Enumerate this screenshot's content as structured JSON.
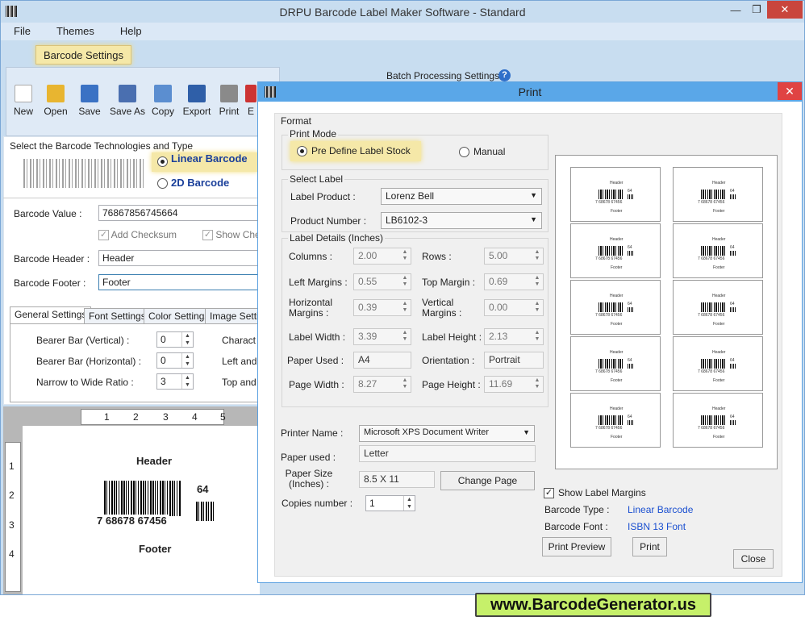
{
  "app": {
    "title": "DRPU Barcode Label Maker Software - Standard",
    "controls": [
      "—",
      "❐",
      "✕"
    ]
  },
  "menu": [
    "File",
    "Themes",
    "Help"
  ],
  "ribbon_tab": "Barcode Settings",
  "batch_label": "Batch Processing Settings",
  "toolbar": [
    "New",
    "Open",
    "Save",
    "Save As",
    "Copy",
    "Export",
    "Print",
    "E"
  ],
  "tech": {
    "caption": "Select the Barcode Technologies and Type",
    "linear": "Linear Barcode",
    "twod": "2D Barcode"
  },
  "fields": {
    "value_label": "Barcode Value :",
    "value": "76867856745664",
    "add_checksum": "Add Checksum",
    "show_checksum": "Show Che",
    "header_label": "Barcode Header :",
    "header": "Header",
    "footer_label": "Barcode Footer :",
    "footer": "Footer"
  },
  "settings_tabs": [
    "General Settings",
    "Font Settings",
    "Color Settings",
    "Image Settin"
  ],
  "general": [
    {
      "label": "Bearer Bar (Vertical) :",
      "value": "0"
    },
    {
      "label": "Bearer Bar (Horizontal) :",
      "value": "0"
    },
    {
      "label": "Narrow to Wide Ratio :",
      "value": "3"
    }
  ],
  "general_right": [
    "Charact",
    "Left and",
    "Top and"
  ],
  "ruler": {
    "h": [
      "1",
      "2",
      "3",
      "4",
      "5"
    ],
    "v": [
      "1",
      "2",
      "3",
      "4"
    ]
  },
  "preview": {
    "header": "Header",
    "digits": "7 68678 67456",
    "addon": "64",
    "footer": "Footer"
  },
  "print": {
    "title": "Print",
    "format": "Format",
    "print_mode": "Print Mode",
    "mode_predefine": "Pre Define Label Stock",
    "mode_manual": "Manual",
    "select_label": "Select Label",
    "label_product_label": "Label Product :",
    "label_product": "Lorenz Bell",
    "product_number_label": "Product Number :",
    "product_number": "LB6102-3",
    "label_details": "Label Details (Inches)",
    "details": [
      {
        "label": "Columns :",
        "value": "2.00"
      },
      {
        "label": "Rows :",
        "value": "5.00"
      },
      {
        "label": "Left Margins :",
        "value": "0.55"
      },
      {
        "label": "Top Margin :",
        "value": "0.69"
      },
      {
        "label": "Horizontal Margins :",
        "value": "0.39"
      },
      {
        "label": "Vertical Margins :",
        "value": "0.00"
      },
      {
        "label": "Label Width :",
        "value": "3.39"
      },
      {
        "label": "Label Height :",
        "value": "2.13"
      },
      {
        "label": "Paper Used :",
        "value": "A4"
      },
      {
        "label": "Orientation :",
        "value": "Portrait"
      },
      {
        "label": "Page Width :",
        "value": "8.27"
      },
      {
        "label": "Page Height :",
        "value": "11.69"
      }
    ],
    "printer_name_label": "Printer Name :",
    "printer_name": "Microsoft XPS Document Writer",
    "paper_used_label": "Paper used :",
    "paper_used": "Letter",
    "paper_size_label": "Paper Size (Inches) :",
    "paper_size": "8.5 X 11",
    "change_page": "Change Page",
    "copies_label": "Copies number :",
    "copies": "1",
    "show_margins": "Show Label Margins",
    "barcode_type_label": "Barcode Type :",
    "barcode_type": "Linear Barcode",
    "barcode_font_label": "Barcode Font :",
    "barcode_font": "ISBN 13 Font",
    "print_preview": "Print Preview",
    "print_btn": "Print",
    "close": "Close",
    "mini_label": {
      "header": "Header",
      "digits": "7 68678 67456",
      "addon": "64",
      "footer": "Footer"
    }
  },
  "banner": "www.BarcodeGenerator.us",
  "colors": {
    "accent": "#5aa7e8",
    "link": "#1a4fd0",
    "highlight": "#f5e8a8"
  }
}
